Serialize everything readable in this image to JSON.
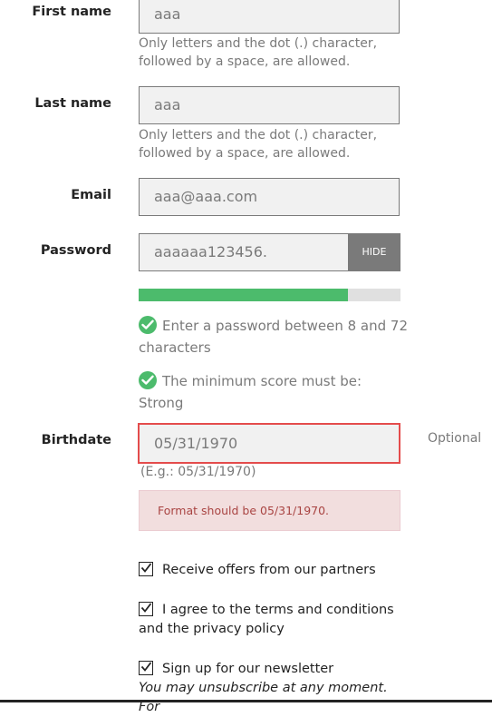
{
  "form": {
    "first_name": {
      "label": "First name",
      "value": "aaa",
      "help_line1": "Only letters and the dot (.) character,",
      "help_line2": "followed by a space, are allowed."
    },
    "last_name": {
      "label": "Last name",
      "value": "aaa",
      "help_line1": "Only letters and the dot (.) character,",
      "help_line2": "followed by a space, are allowed."
    },
    "email": {
      "label": "Email",
      "value": "aaa@aaa.com"
    },
    "password": {
      "label": "Password",
      "value": "aaaaaa123456.",
      "hide_label": "HIDE",
      "strength_fraction": 0.8,
      "rule1_line1": "Enter a password between 8 and 72",
      "rule1_line2": "characters",
      "rule2": "The minimum score must be: Strong"
    },
    "birthdate": {
      "label": "Birthdate",
      "value": "05/31/1970",
      "optional_label": "Optional",
      "example": "(E.g.: 05/31/1970)",
      "error": "Format should be 05/31/1970."
    },
    "checkboxes": {
      "partners": "Receive offers from our partners",
      "terms_line1": "I agree to the terms and conditions",
      "terms_line2": "and the privacy policy",
      "newsletter": "Sign up for our newsletter",
      "newsletter_note": "You may unsubscribe at any moment. For"
    }
  },
  "colors": {
    "success": "#4cbb6c",
    "error_border": "#e44c4c",
    "error_bg": "#f2dede",
    "error_text": "#a94442",
    "hide_button_bg": "#7a7a7a"
  }
}
